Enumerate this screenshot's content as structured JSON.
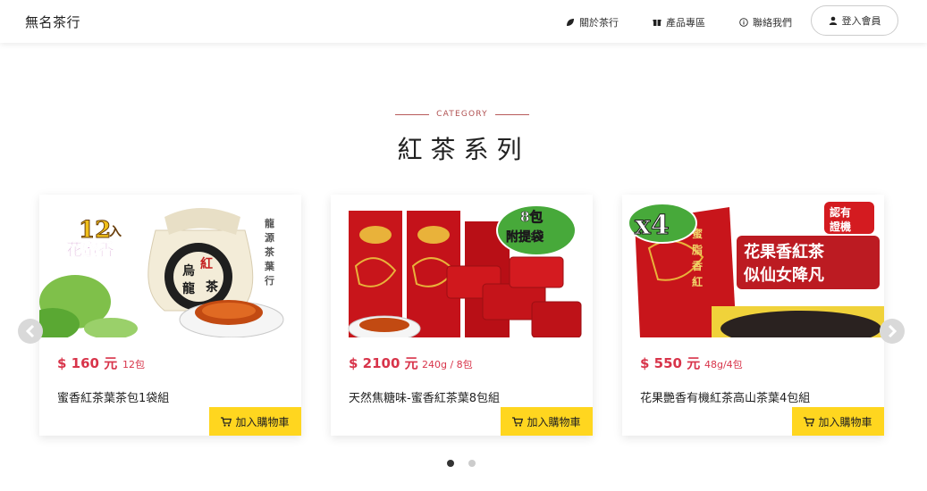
{
  "navbar": {
    "brand": "無名茶行",
    "about": "關於茶行",
    "products": "產品專區",
    "contact": "聯絡我們",
    "login": "登入會員"
  },
  "section": {
    "eyebrow": "CATEGORY",
    "title": "紅茶系列"
  },
  "products": [
    {
      "price": "$ 160 元",
      "unit": "12包",
      "name": "蜜香紅茶葉茶包1袋組",
      "cart": "加入購物車",
      "badge": "12入",
      "badge_sub": "花蜜香",
      "bag_text": "烏龍紅茶",
      "brand_text": "龍源茶葉行"
    },
    {
      "price": "$ 2100 元",
      "unit": "240g / 8包",
      "name": "天然焦糖味-蜜香紅茶葉8包組",
      "cart": "加入購物車",
      "badge": "8包",
      "badge_sub": "附提袋"
    },
    {
      "price": "$ 550 元",
      "unit": "48g/4包",
      "name": "花果艷香有機紅茶高山茶葉4包組",
      "cart": "加入購物車",
      "badge": "x4",
      "badge_sub": "認有證機",
      "banner_line1": "花果香紅茶",
      "banner_line2": "似仙女降凡",
      "pack_text": "蜜脂香紅"
    }
  ],
  "colors": {
    "price": "#d8344a",
    "cart_button": "#ffd61f",
    "eyebrow": "#b05050"
  }
}
